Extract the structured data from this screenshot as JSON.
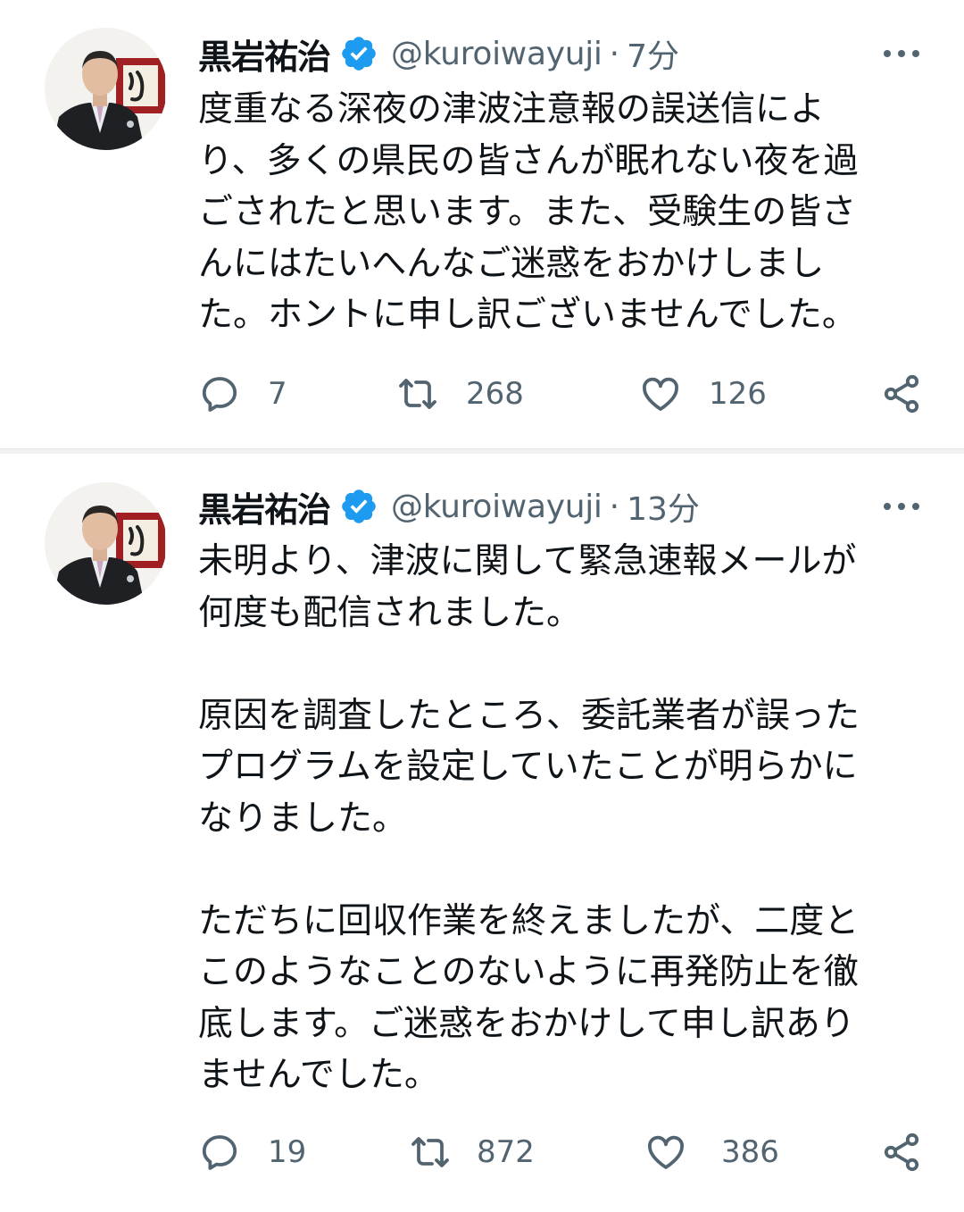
{
  "tweets": [
    {
      "author": {
        "name": "黒岩祐治",
        "handle": "@kuroiwayuji",
        "verified": true
      },
      "time": "7分",
      "text": "度重なる深夜の津波注意報の誤送信によ\nり、多くの県民の皆さんが眠れない夜を過\nごされたと思います。また、受験生の皆さ\nんにはたいへんなご迷惑をおかけしまし\nた。ホントに申し訳ございませんでした。",
      "stats": {
        "replies": "7",
        "retweets": "268",
        "likes": "126"
      }
    },
    {
      "author": {
        "name": "黒岩祐治",
        "handle": "@kuroiwayuji",
        "verified": true
      },
      "time": "13分",
      "text": "未明より、津波に関して緊急速報メールが\n何度も配信されました。\n\n原因を調査したところ、委託業者が誤った\nプログラムを設定していたことが明らかに\nなりました。\n\nただちに回収作業を終えましたが、二度と\nこのようなことのないように再発防止を徹\n底します。ご迷惑をおかけして申し訳あり\nませんでした。",
      "stats": {
        "replies": "19",
        "retweets": "872",
        "likes": "386"
      }
    }
  ],
  "icons": {
    "verified": "verified-badge-icon",
    "more": "more-dots-icon",
    "reply": "reply-bubble-icon",
    "retweet": "retweet-arrows-icon",
    "like": "heart-icon",
    "share": "share-nodes-icon"
  },
  "colors": {
    "verified_blue": "#1d9bf0",
    "text_primary": "#0f1419",
    "text_secondary": "#536471",
    "divider": "#eff1f3"
  }
}
